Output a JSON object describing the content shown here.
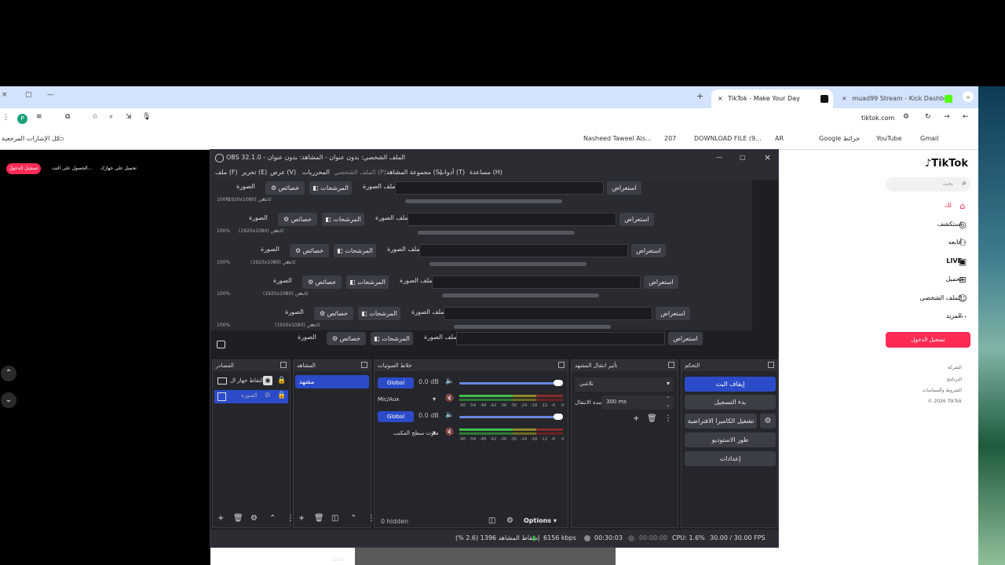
{
  "browser": {
    "tabs": [
      {
        "label": "TikTok - Make Your Day",
        "active": true
      },
      {
        "label": "muad99 Stream - Kick Dashboa",
        "active": false
      }
    ],
    "address": "tiktok.com",
    "profile_initial": "P",
    "bookmarks": [
      "Nasheed Taweel Als...",
      "207",
      "DOWNLOAD FILE (9...",
      "AR",
      "Google خرائط",
      "YouTube",
      "Gmail"
    ],
    "all_bookmarks_label": "كل الإشارات المرجعية"
  },
  "tiktok": {
    "logo": "TikTok",
    "search_placeholder": "بحث",
    "menu": [
      "لك",
      "استكشف",
      "أتابعه",
      "LIVE",
      "تحميل",
      "الملف الشخصي",
      "المزيد"
    ],
    "login_button": "تسجيل الدخول",
    "footer": [
      "الشركة",
      "البرنامج",
      "الشروط والسياسات",
      "© 2026 TikTok"
    ],
    "top_login_small": "تسجيل الدخول",
    "top_link_1": "الحصول على التت...",
    "top_link_2": "تحميل على جهازك"
  },
  "obs": {
    "title": "OBS 32.1.0 - الملف الشخصي: بدون عنوان - المشاهد: بدون عنوان",
    "menu": [
      "ملف (F)",
      "تحرير (E)",
      "عرض (V)",
      "المحرريات",
      "الملف الشخصي (P)",
      "مجموعة المشاهد (S)",
      "أدوات (T)",
      "مساعدة (H)"
    ],
    "properties_row": {
      "browse": "استعراض",
      "file_label": "ملف الصورة",
      "filters": "المرشحات",
      "properties": "خصائص",
      "image": "الصورة",
      "size_tag": "(1920x1080) كانفس",
      "zoom": "100%"
    },
    "docks": {
      "sources_title": "المصادر",
      "scenes_title": "المشاهد",
      "mixer_title": "خلاط الصوتيات",
      "transition_title": "تأثير انتقال المشهد",
      "controls_title": "التحكم"
    },
    "sources": [
      "التقاط جهاز ال",
      "الصورة"
    ],
    "scenes": [
      "مشهد"
    ],
    "mixer": [
      {
        "name": "Global",
        "db": "0.0 dB"
      },
      {
        "name": "Mic/Aux",
        "db": ""
      },
      {
        "name": "Global",
        "db": "0.0 dB"
      },
      {
        "name": "صوت سطح المكتب",
        "db": ""
      }
    ],
    "meter_ticks": [
      "-60",
      "-54",
      "-48",
      "-42",
      "-36",
      "-30",
      "-24",
      "-18",
      "-12",
      "-6",
      "0"
    ],
    "mixer_hidden": "0 hidden",
    "mixer_options": "Options",
    "transition": {
      "type": "تلاشي",
      "duration_label": "مدة الانتقال",
      "duration": "300 ms"
    },
    "controls": [
      "إيقاف البث",
      "بدء التسجيل",
      "تشغيل الكاميرا الافتراضية",
      "طور الاستوديو",
      "إعدادات"
    ],
    "status": {
      "dropped": "إسقاط المشاهد 1396 (2.6 %)",
      "kbps": "6156 kbps",
      "stream_time": "00:30:03",
      "rec_time": "00:00:00",
      "cpu": "CPU: 1.6%",
      "fps": "30.00 / 30.00 FPS"
    },
    "under_label": "1038"
  },
  "colors": {
    "tiktok_red": "#fe2c55",
    "obs_blue": "#2b4bc9",
    "obs_bg": "#1e1f23"
  }
}
